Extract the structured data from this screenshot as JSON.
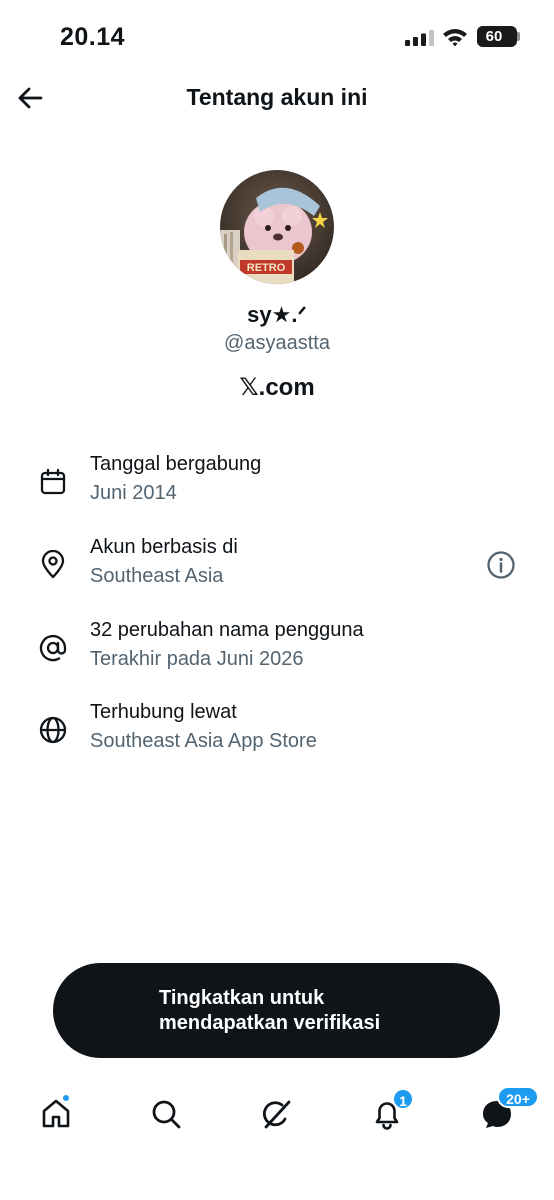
{
  "status_bar": {
    "time": "20.14",
    "battery": "60",
    "battery_level": 0.6,
    "icons": [
      "signal-icon",
      "wifi-icon",
      "battery-icon"
    ]
  },
  "header": {
    "title": "Tentang akun ini",
    "back_icon": "arrow-left-icon"
  },
  "profile": {
    "display_name": "sy★.ᐟ",
    "handle": "@asyaastta",
    "site": "𝕏.com"
  },
  "info_rows": [
    {
      "icon": "calendar-icon",
      "title": "Tanggal bergabung",
      "subtitle": "Juni 2014"
    },
    {
      "icon": "location-pin-icon",
      "title": "Akun berbasis di",
      "subtitle": "Southeast Asia",
      "action_icon": "info-icon"
    },
    {
      "icon": "at-sign-icon",
      "title": "32 perubahan nama pengguna",
      "subtitle": "Terakhir pada Juni 2026"
    },
    {
      "icon": "globe-icon",
      "title": "Terhubung lewat",
      "subtitle": "Southeast Asia App Store"
    }
  ],
  "cta": {
    "line1": "Tingkatkan untuk",
    "line2": "mendapatkan verifikasi"
  },
  "tabbar": {
    "tabs": [
      {
        "name": "home",
        "icon": "home-icon",
        "has_dot": true
      },
      {
        "name": "search",
        "icon": "search-icon"
      },
      {
        "name": "grok",
        "icon": "grok-icon"
      },
      {
        "name": "notifications",
        "icon": "bell-icon",
        "badge": "1"
      },
      {
        "name": "messages",
        "icon": "message-icon",
        "badge": "20+"
      }
    ]
  },
  "colors": {
    "text_primary": "#0f1419",
    "text_secondary": "#536471",
    "accent": "#1d9bf0",
    "cta_background": "#0f1419"
  }
}
